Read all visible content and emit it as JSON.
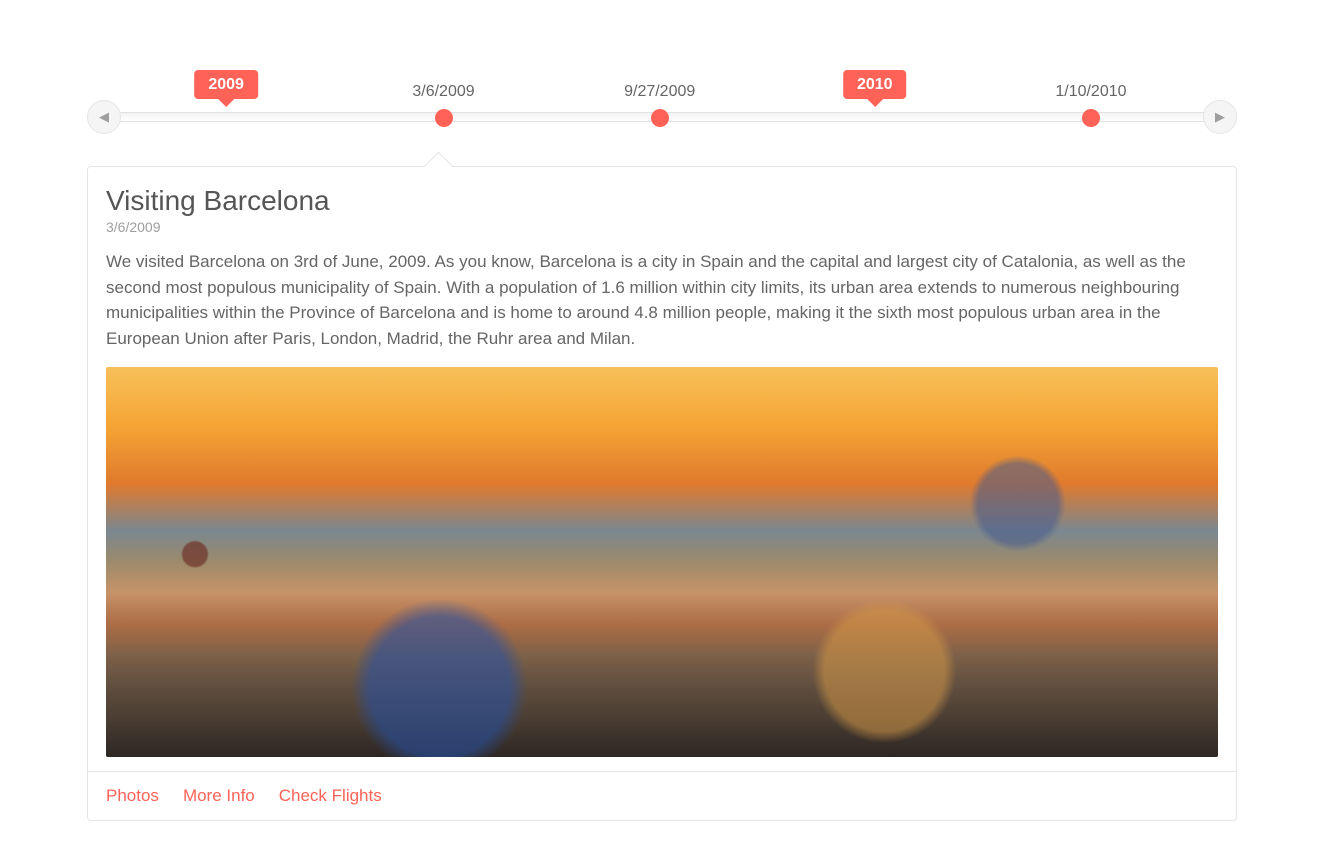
{
  "timeline": {
    "flags": [
      {
        "label": "2009",
        "leftPct": 12.1
      },
      {
        "label": "2010",
        "leftPct": 68.5
      }
    ],
    "events": [
      {
        "label": "3/6/2009",
        "leftPct": 31.0,
        "active": true
      },
      {
        "label": "9/27/2009",
        "leftPct": 49.8,
        "active": false
      },
      {
        "label": "1/10/2010",
        "leftPct": 87.3,
        "active": false
      }
    ]
  },
  "card": {
    "title": "Visiting Barcelona",
    "subtitle": "3/6/2009",
    "body": "We visited Barcelona on 3rd of June, 2009. As you know, Barcelona is a city in Spain and the capital and largest city of Catalonia, as well as the second most populous municipality of Spain. With a population of 1.6 million within city limits, its urban area extends to numerous neighbouring municipalities within the Province of Barcelona and is home to around 4.8 million people, making it the sixth most populous urban area in the European Union after Paris, London, Madrid, the Ruhr area and Milan.",
    "imageAlt": "Barcelona cityscape at sunset from Park Güell",
    "actions": [
      {
        "label": "Photos"
      },
      {
        "label": "More Info"
      },
      {
        "label": "Check Flights"
      }
    ]
  }
}
